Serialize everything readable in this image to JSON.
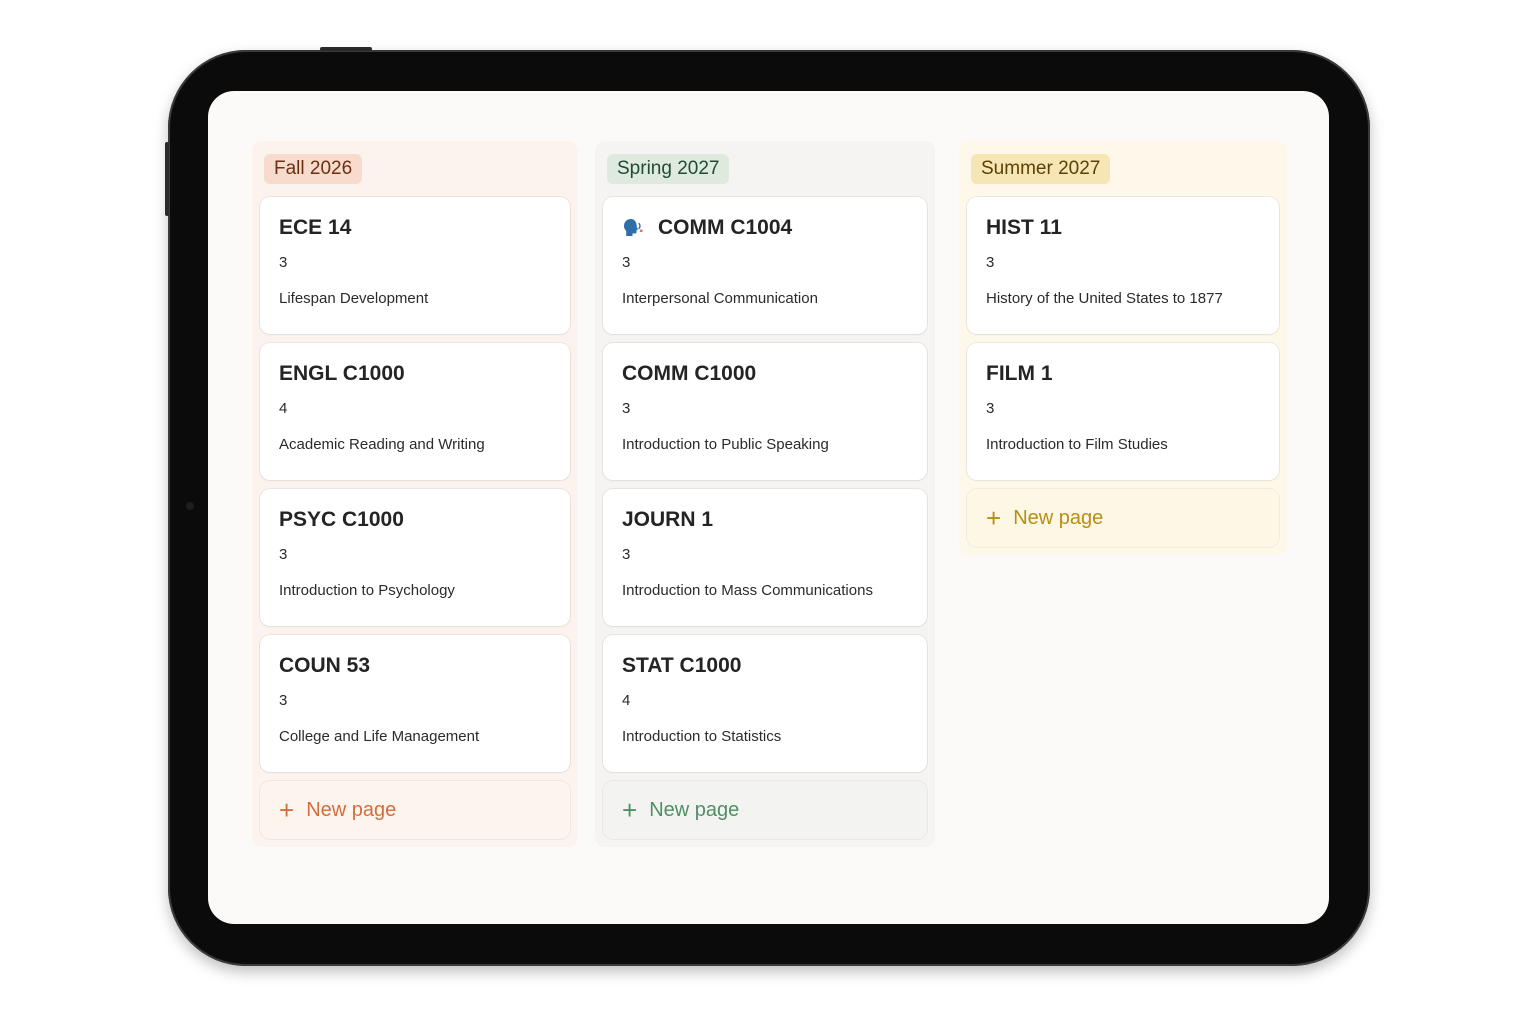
{
  "board": {
    "columns": [
      {
        "label": "Fall 2026",
        "cards": [
          {
            "code": "ECE 14",
            "credits": "3",
            "name": "Lifespan Development"
          },
          {
            "code": "ENGL C1000",
            "credits": "4",
            "name": "Academic Reading and Writing"
          },
          {
            "code": "PSYC C1000",
            "credits": "3",
            "name": "Introduction to Psychology"
          },
          {
            "code": "COUN 53",
            "credits": "3",
            "name": "College and Life Management"
          }
        ],
        "new_page_label": "New page"
      },
      {
        "label": "Spring 2027",
        "cards": [
          {
            "code": "COMM C1004",
            "credits": "3",
            "name": "Interpersonal Communication",
            "icon": "speaking-head-icon"
          },
          {
            "code": "COMM C1000",
            "credits": "3",
            "name": "Introduction to Public Speaking"
          },
          {
            "code": "JOURN 1",
            "credits": "3",
            "name": "Introduction to Mass Communications"
          },
          {
            "code": "STAT C1000",
            "credits": "4",
            "name": "Introduction to Statistics"
          }
        ],
        "new_page_label": "New page"
      },
      {
        "label": "Summer 2027",
        "cards": [
          {
            "code": "HIST 11",
            "credits": "3",
            "name": "History of the United States to 1877"
          },
          {
            "code": "FILM 1",
            "credits": "3",
            "name": "Introduction to Film Studies"
          }
        ],
        "new_page_label": "New page"
      }
    ],
    "colors": {
      "fall_accent": "#cf6f3e",
      "spring_accent": "#4f8f64",
      "summer_accent": "#b98e13",
      "icon_blue": "#2f6fa8"
    }
  }
}
